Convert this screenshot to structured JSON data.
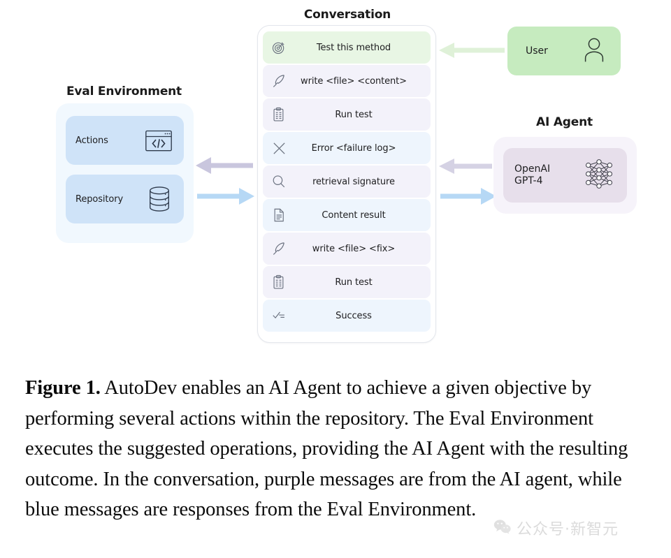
{
  "figure": {
    "conversation": {
      "title": "Conversation",
      "messages": [
        {
          "icon": "target-icon",
          "text": "Test this method",
          "role": "user"
        },
        {
          "icon": "quill-icon",
          "text": "write <file> <content>",
          "role": "agent"
        },
        {
          "icon": "clipboard-icon",
          "text": "Run test",
          "role": "agent"
        },
        {
          "icon": "x-icon",
          "text": "Error <failure log>",
          "role": "env"
        },
        {
          "icon": "search-icon",
          "text": "retrieval signature",
          "role": "agent"
        },
        {
          "icon": "document-icon",
          "text": "Content result",
          "role": "env"
        },
        {
          "icon": "quill-icon",
          "text": "write <file> <fix>",
          "role": "agent"
        },
        {
          "icon": "clipboard-icon",
          "text": "Run test",
          "role": "agent"
        },
        {
          "icon": "checklist-icon",
          "text": "Success",
          "role": "env"
        }
      ]
    },
    "eval_environment": {
      "title": "Eval Environment",
      "cards": [
        {
          "label": "Actions",
          "icon": "code-window-icon"
        },
        {
          "label": "Repository",
          "icon": "database-icon"
        }
      ]
    },
    "user": {
      "label": "User",
      "icon": "person-icon"
    },
    "ai_agent": {
      "title": "AI Agent",
      "model_label": "OpenAI\nGPT-4",
      "icon": "neural-network-icon"
    },
    "arrows": [
      {
        "name": "user-to-conversation",
        "direction": "left",
        "color": "#ddf0d6"
      },
      {
        "name": "conversation-to-eval",
        "direction": "left",
        "color": "#c9c6de"
      },
      {
        "name": "eval-to-conversation",
        "direction": "right",
        "color": "#b6d8f5"
      },
      {
        "name": "agent-to-conversation",
        "direction": "left",
        "color": "#d5d2e4"
      },
      {
        "name": "conversation-to-agent",
        "direction": "right",
        "color": "#b6d8f5"
      }
    ],
    "colors": {
      "user_message_bg": "#e8f6e4",
      "agent_message_bg": "#f3f2fa",
      "env_message_bg": "#eef5fd",
      "eval_outer_bg": "#f1f8fe",
      "eval_card_bg": "#cfe3f8",
      "user_box_bg": "#c6ebbf",
      "agent_outer_bg": "#f6f3fa",
      "agent_card_bg": "#e7dfeb"
    }
  },
  "caption": {
    "label": "Figure 1.",
    "body": " AutoDev enables an AI Agent to achieve a given objective by performing several actions within the repository. The Eval Environment executes the suggested operations, providing the AI Agent with the resulting outcome. In the conversation, purple messages are from the AI agent, while blue messages are responses from the Eval Environment."
  },
  "watermark": {
    "text": "公众号·新智元",
    "icon": "wechat-icon"
  }
}
